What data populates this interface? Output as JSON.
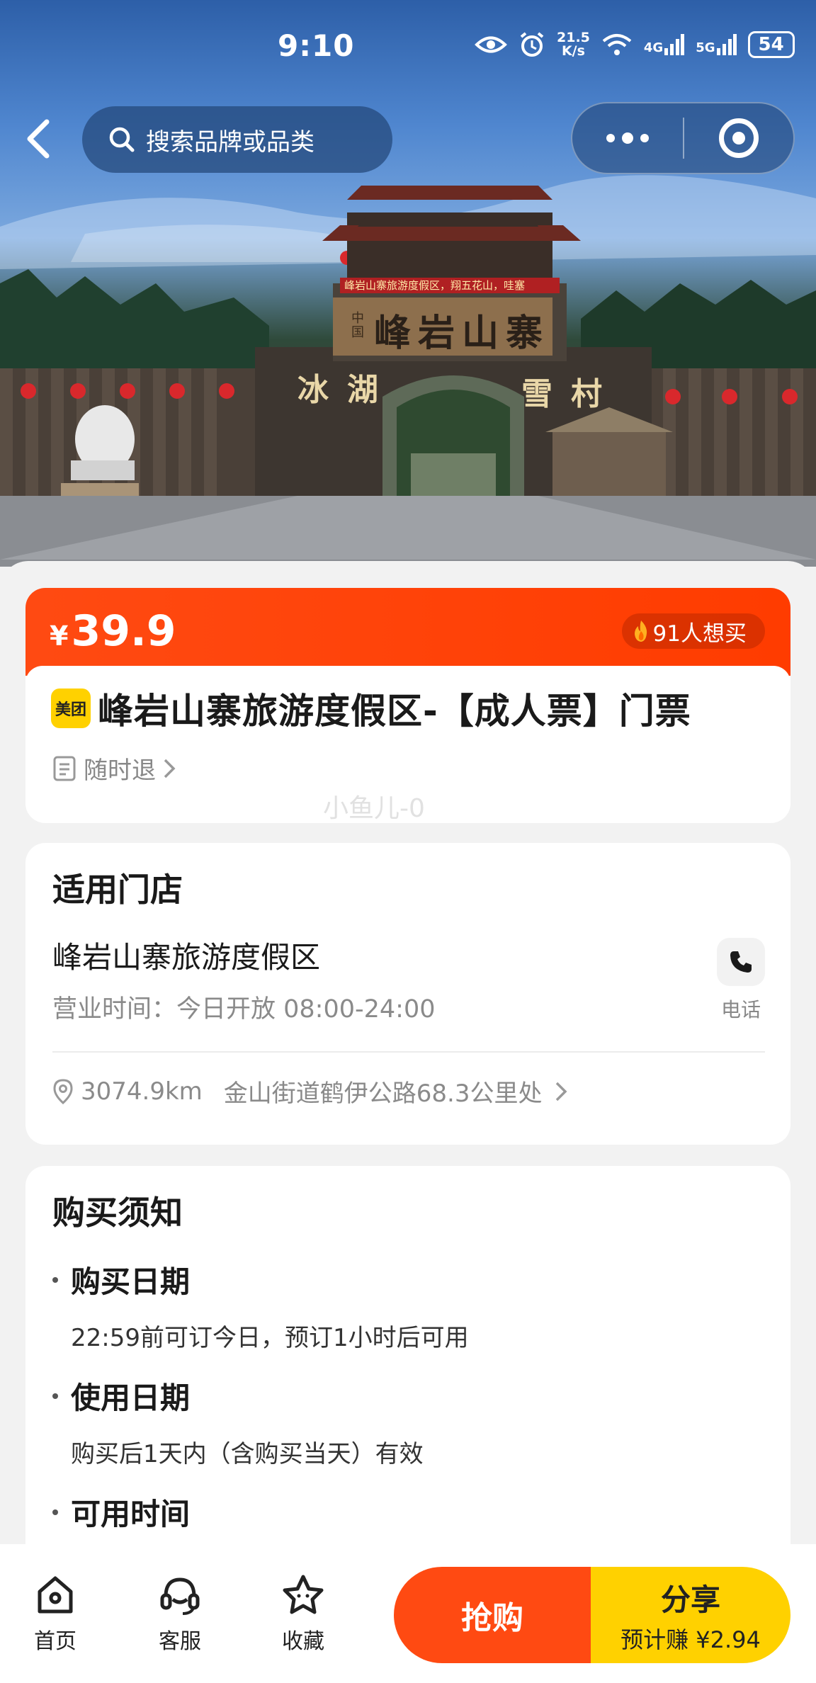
{
  "status_bar": {
    "time": "9:10",
    "net_speed_value": "21.5",
    "net_speed_unit": "K/s",
    "signal_1": "4G",
    "signal_2": "5G",
    "battery": "54"
  },
  "header": {
    "search_placeholder": "搜索品牌或品类"
  },
  "hero": {
    "gate_sign": "峰岩山寨",
    "gate_small": "中国",
    "gate_left": "冰湖",
    "gate_right": "雪村",
    "banner": "峰岩山寨旅游度假区，翔五花山，哇塞"
  },
  "product": {
    "currency": "¥",
    "price": "39.9",
    "want_count": "91人想买",
    "brand_badge": "美团",
    "title": "峰岩山寨旅游度假区-【成人票】门票",
    "refund_tag": "随时退"
  },
  "watermark": "小鱼儿-0",
  "store": {
    "section_title": "适用门店",
    "name": "峰岩山寨旅游度假区",
    "hours": "营业时间：今日开放 08:00-24:00",
    "phone_label": "电话",
    "distance": "3074.9km",
    "address": "金山街道鹤伊公路68.3公里处"
  },
  "notice": {
    "section_title": "购买须知",
    "items": [
      {
        "title": "购买日期",
        "desc": "22:59前可订今日，预订1小时后可用"
      },
      {
        "title": "使用日期",
        "desc": "购买后1天内（含购买当天）有效"
      },
      {
        "title": "可用时间",
        "desc": ""
      }
    ]
  },
  "bottom_bar": {
    "tabs": [
      {
        "label": "首页",
        "icon": "home-icon"
      },
      {
        "label": "客服",
        "icon": "headset-icon"
      },
      {
        "label": "收藏",
        "icon": "star-icon"
      }
    ],
    "buy_label": "抢购",
    "share_label": "分享",
    "share_earn": "预计赚 ¥2.94"
  },
  "colors": {
    "accent_orange": "#ff4a12",
    "share_yellow": "#ffd100"
  }
}
